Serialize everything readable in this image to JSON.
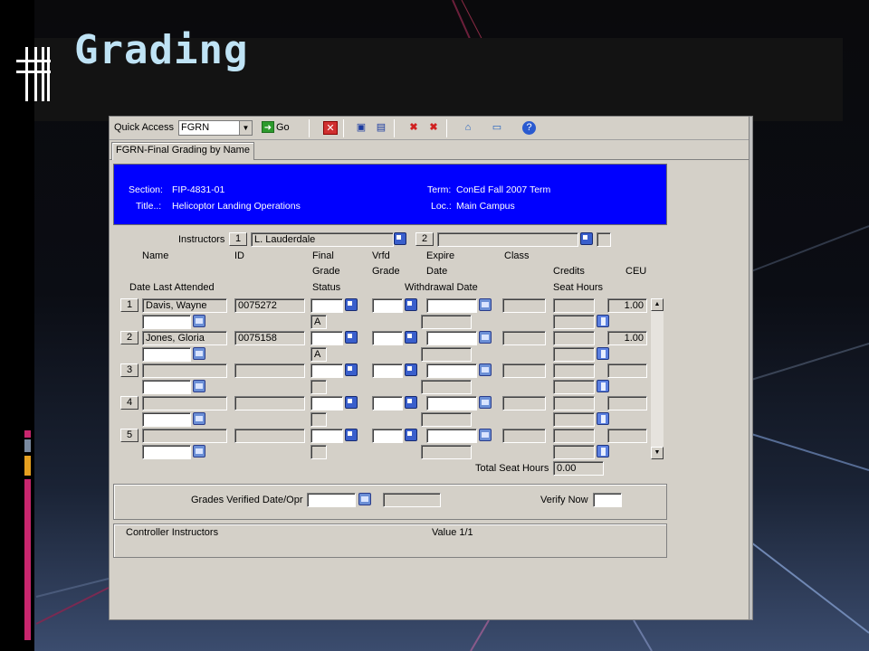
{
  "slide": {
    "title": "Grading"
  },
  "toolbar": {
    "quick_access_label": "Quick Access",
    "quick_access_value": "FGRN",
    "go_label": "Go",
    "icons": [
      "delete-record-icon",
      "save-icon",
      "save-all-icon",
      "cancel-icon",
      "remove-icon",
      "clear-icon",
      "window-icon",
      "help-icon"
    ]
  },
  "tab": {
    "label": "FGRN-Final Grading by Name"
  },
  "header": {
    "section_label": "Section:",
    "section_value": "FIP-4831-01",
    "title_label": "Title..:",
    "title_value": "Helicoptor Landing Operations",
    "term_label": "Term:",
    "term_value": "ConEd Fall 2007 Term",
    "loc_label": "Loc.:",
    "loc_value": "Main Campus"
  },
  "instructors": {
    "label": "Instructors",
    "num1": "1",
    "name1": "L. Lauderdale",
    "num2": "2",
    "name2": ""
  },
  "columns": {
    "name": "Name",
    "id": "ID",
    "final": "Final",
    "grade": "Grade",
    "status": "Status",
    "vrfd": "Vrfd",
    "vrfd_grade": "Grade",
    "expire": "Expire",
    "date": "Date",
    "withdrawal": "Withdrawal Date",
    "class": "Class",
    "credits": "Credits",
    "seat_hours": "Seat Hours",
    "ceu": "CEU",
    "date_last_attended": "Date Last Attended"
  },
  "rows": [
    {
      "num": "1",
      "name": "Davis, Wayne",
      "id": "0075272",
      "status": "A",
      "ceu": "1.00"
    },
    {
      "num": "2",
      "name": "Jones, Gloria",
      "id": "0075158",
      "status": "A",
      "ceu": "1.00"
    },
    {
      "num": "3",
      "name": "",
      "id": "",
      "status": "",
      "ceu": ""
    },
    {
      "num": "4",
      "name": "",
      "id": "",
      "status": "",
      "ceu": ""
    },
    {
      "num": "5",
      "name": "",
      "id": "",
      "status": "",
      "ceu": ""
    }
  ],
  "totals": {
    "label": "Total Seat Hours",
    "value": "0.00"
  },
  "verify": {
    "grades_verified_label": "Grades Verified Date/Opr",
    "verify_now_label": "Verify Now"
  },
  "status_bar": {
    "controller": "Controller Instructors",
    "value": "Value 1/1"
  }
}
